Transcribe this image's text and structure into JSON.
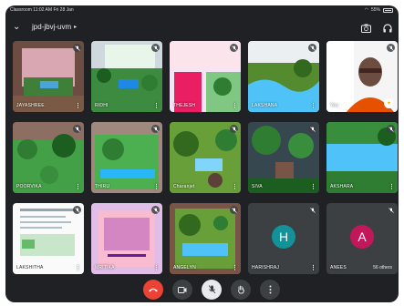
{
  "status": {
    "carrier": "Classroom",
    "time_date": "11:02 AM Fri 28 Jan",
    "battery": "55%"
  },
  "meeting": {
    "code": "jpd-jbvj-uvm",
    "code_arrow": "▸"
  },
  "tiles": [
    {
      "name": "JAYASHREE"
    },
    {
      "name": "RIDHI"
    },
    {
      "name": "THEJESH"
    },
    {
      "name": "LAKSHANA"
    },
    {
      "name": "You"
    },
    {
      "name": "POORVIKA"
    },
    {
      "name": "THIRU"
    },
    {
      "name": "Charanjet"
    },
    {
      "name": "SIVA"
    },
    {
      "name": "AKSHARA"
    },
    {
      "name": "LAKSHITHA"
    },
    {
      "name": "MRITIKA"
    },
    {
      "name": "ANGELYN"
    },
    {
      "name": "HARISHRAJ",
      "initial": "H",
      "color": "#12939a"
    },
    {
      "name": "ANEES",
      "initial": "A",
      "color": "#c2185b",
      "others": "56 others"
    }
  ],
  "menu_glyph": "⋮",
  "colors": {
    "background": "#202124",
    "tile": "#3c4043",
    "end_call": "#ea4335"
  },
  "icons": [
    "chevron-down-icon",
    "camera-flip-icon",
    "headset-icon",
    "mic-off-icon",
    "end-call-icon",
    "video-icon",
    "raise-hand-icon",
    "more-vert-icon"
  ]
}
